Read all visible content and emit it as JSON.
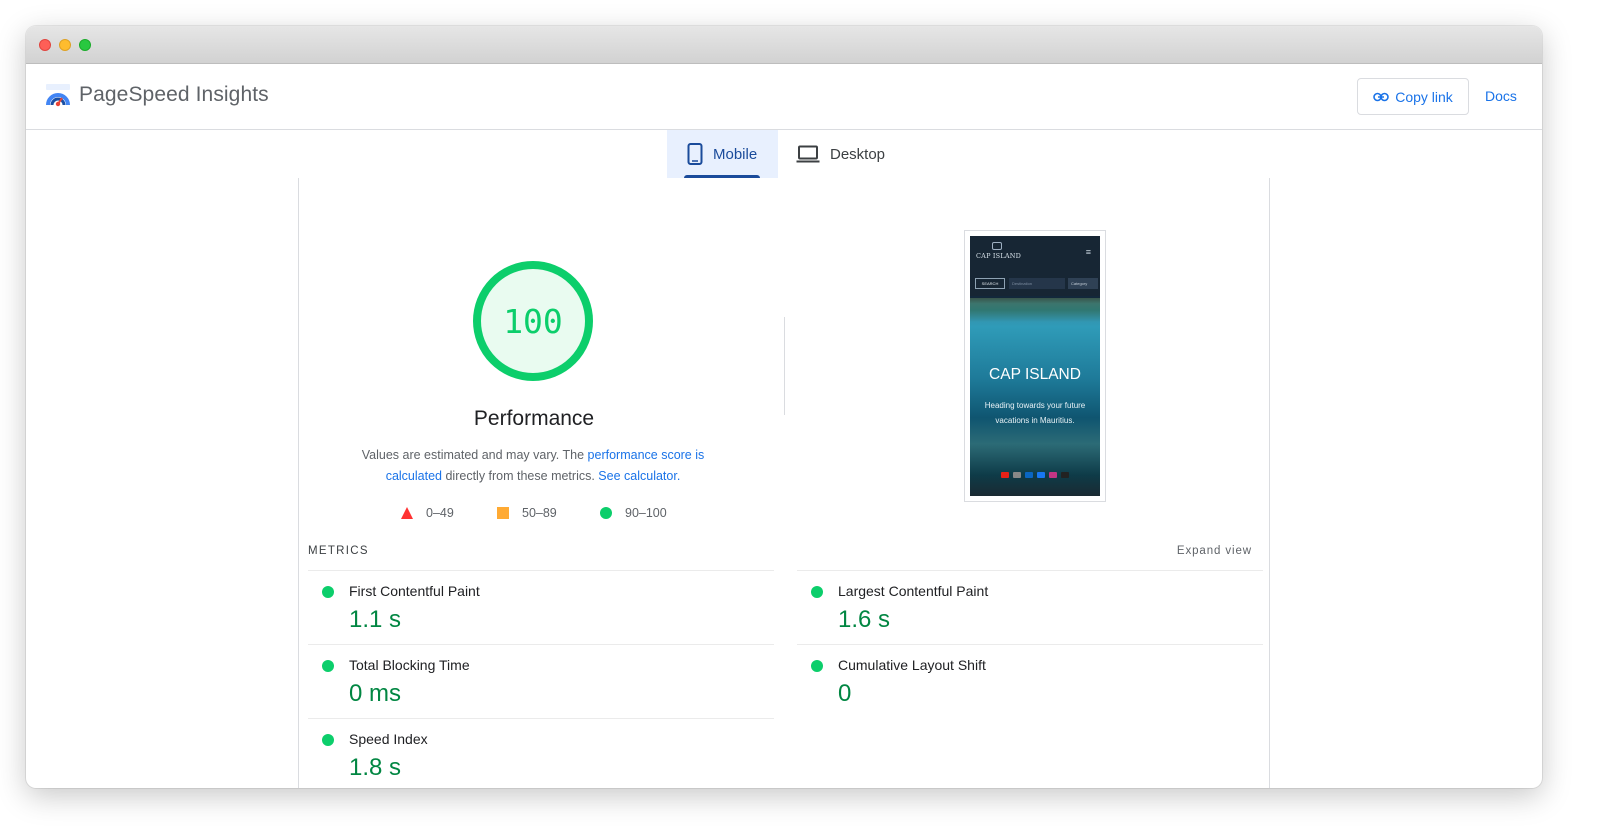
{
  "app": {
    "name": "PageSpeed Insights"
  },
  "header": {
    "copy_link_label": "Copy link",
    "docs_label": "Docs"
  },
  "tabs": [
    {
      "label": "Mobile",
      "selected": true
    },
    {
      "label": "Desktop",
      "selected": false
    }
  ],
  "performance": {
    "score": "100",
    "score_fraction": 1.0,
    "title": "Performance",
    "desc_prefix": "Values are estimated and may vary. The ",
    "desc_link1": "performance score is calculated",
    "desc_middle": " directly from these metrics. ",
    "desc_link2": "See calculator.",
    "color": "#0cce6b"
  },
  "legend": [
    {
      "range": "0–49",
      "color": "#ff3333",
      "shape": "triangle"
    },
    {
      "range": "50–89",
      "color": "#ffaa33",
      "shape": "square"
    },
    {
      "range": "90–100",
      "color": "#0cce6b",
      "shape": "circle"
    }
  ],
  "screenshot_preview": {
    "logo": "CAP ISLAND",
    "search_button": "SEARCH",
    "search_placeholder": "Destination",
    "category": "Category",
    "title": "CAP ISLAND",
    "subtitle": "Heading towards your future vacations in Mauritius."
  },
  "metrics": {
    "section_label": "METRICS",
    "expand_label": "Expand view",
    "items": [
      {
        "name": "First Contentful Paint",
        "value": "1.1 s"
      },
      {
        "name": "Total Blocking Time",
        "value": "0 ms"
      },
      {
        "name": "Speed Index",
        "value": "1.8 s"
      },
      {
        "name": "Largest Contentful Paint",
        "value": "1.6 s"
      },
      {
        "name": "Cumulative Layout Shift",
        "value": "0"
      }
    ]
  },
  "icons": [
    "pagespeed-logo-icon",
    "link-icon",
    "mobile-phone-icon",
    "laptop-icon"
  ]
}
